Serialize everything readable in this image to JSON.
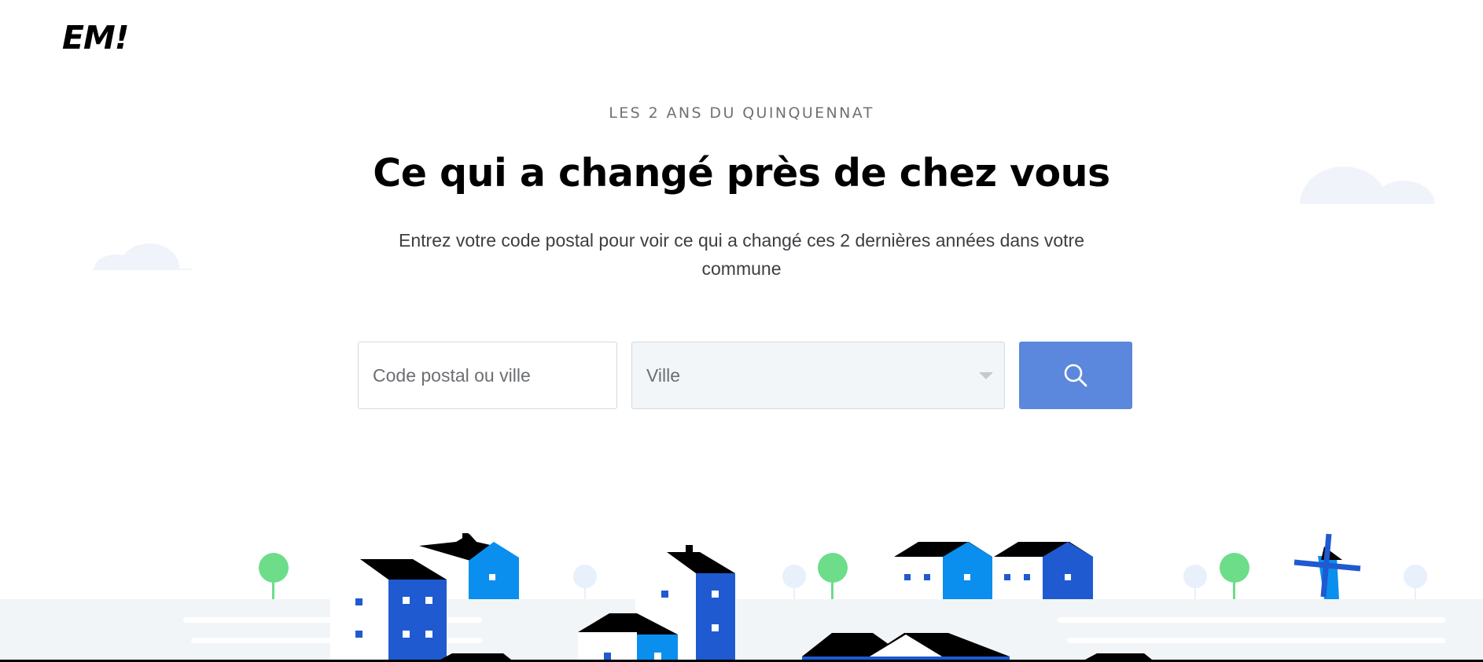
{
  "header": {
    "logo_text": "EM!"
  },
  "hero": {
    "kicker": "LES 2 ANS DU QUINQUENNAT",
    "title": "Ce qui a changé près de chez vous",
    "subtitle": "Entrez votre code postal pour voir ce qui a changé ces 2 dernières années dans votre commune"
  },
  "search": {
    "postal_placeholder": "Code postal ou ville",
    "postal_value": "",
    "city_select_value": "Ville",
    "search_icon": "search-icon"
  },
  "colors": {
    "accent": "#5b88dc",
    "building_dark_blue": "#1f5ad0",
    "building_light_blue": "#0a8fee",
    "tree_green": "#6ddd8a",
    "ground": "#f2f5f8",
    "roof": "#000000"
  }
}
